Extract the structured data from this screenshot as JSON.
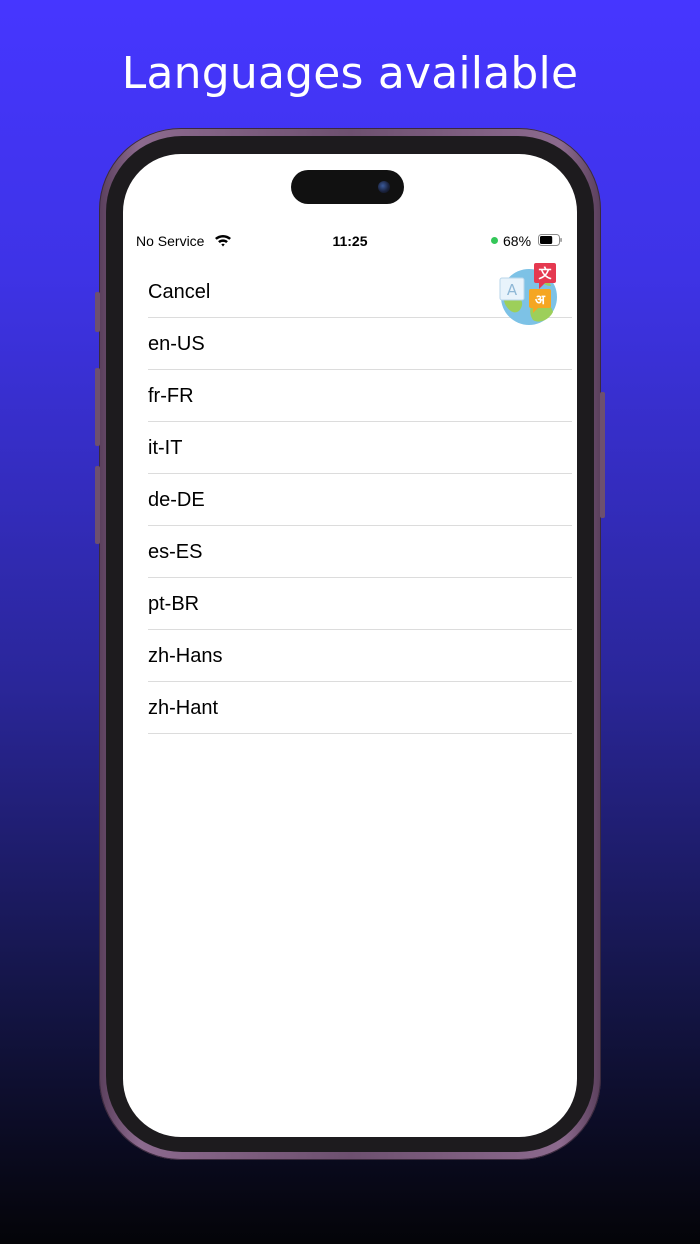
{
  "headline": "Languages available",
  "status_bar": {
    "carrier": "No Service",
    "time": "11:25",
    "battery_percent": "68%",
    "battery_level": 0.68,
    "icons": [
      "wifi-icon",
      "battery-icon"
    ]
  },
  "list": {
    "cancel_label": "Cancel",
    "languages": [
      "en-US",
      "fr-FR",
      "it-IT",
      "de-DE",
      "es-ES",
      "pt-BR",
      "zh-Hans",
      "zh-Hant"
    ]
  },
  "translate_icon": {
    "glyph_a": "A",
    "glyph_wen": "文",
    "glyph_a_hindi": "अ"
  },
  "colors": {
    "background_top": "#4636ff",
    "background_bottom": "#040408",
    "separator": "#dcdcdc",
    "battery_dot": "#34c759"
  }
}
